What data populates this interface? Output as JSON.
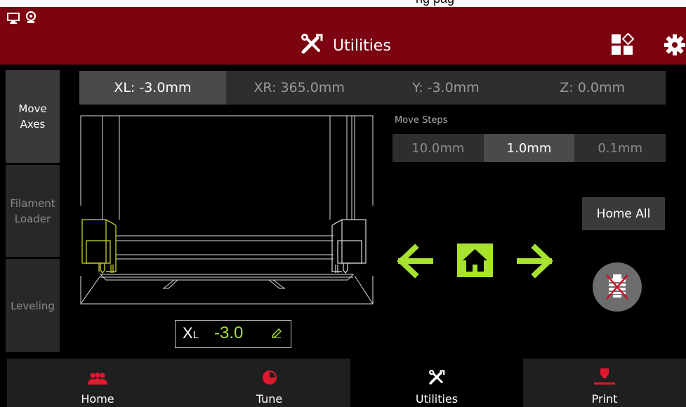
{
  "top_strip": {
    "partial_text": "ng pag"
  },
  "header": {
    "title": "Utilities",
    "icons": [
      "monitor-icon",
      "webcam-icon",
      "tools-icon",
      "dashboard-icon",
      "gear-icon"
    ],
    "color": "#7b0410"
  },
  "sidebar": {
    "items": [
      {
        "label": "Move\nAxes",
        "active": true
      },
      {
        "label": "Filament\nLoader",
        "active": false
      },
      {
        "label": "Leveling",
        "active": false
      }
    ]
  },
  "axes": {
    "tabs": [
      {
        "label": "XL: -3.0mm",
        "active": true
      },
      {
        "label": "XR: 365.0mm",
        "active": false
      },
      {
        "label": "Y: -3.0mm",
        "active": false
      },
      {
        "label": "Z: 0.0mm",
        "active": false
      }
    ]
  },
  "readout": {
    "axis_main": "X",
    "axis_sub": "L",
    "value": "-3.0"
  },
  "move_steps": {
    "label": "Move Steps",
    "options": [
      {
        "label": "10.0mm",
        "active": false
      },
      {
        "label": "1.0mm",
        "active": true
      },
      {
        "label": "0.1mm",
        "active": false
      }
    ]
  },
  "controls": {
    "home_all": "Home All",
    "accent": "#a6e22e",
    "icons": [
      "arrow-left-icon",
      "home-icon",
      "arrow-right-icon",
      "disable-motors-icon"
    ]
  },
  "bottom_nav": {
    "items": [
      {
        "label": "Home",
        "icon": "users-icon",
        "active": false
      },
      {
        "label": "Tune",
        "icon": "pie-chart-icon",
        "active": false
      },
      {
        "label": "Utilities",
        "icon": "tools-icon",
        "active": true
      },
      {
        "label": "Print",
        "icon": "print-icon",
        "active": false
      }
    ]
  }
}
